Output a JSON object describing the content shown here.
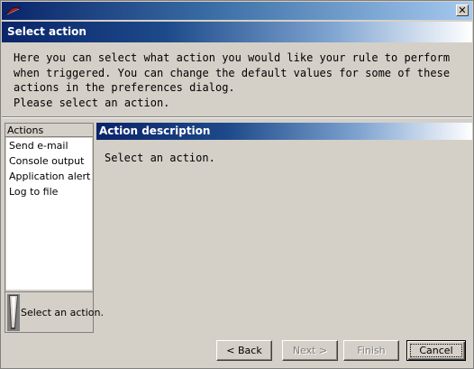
{
  "window": {
    "close_glyph": "✕"
  },
  "header": {
    "title": "Select action"
  },
  "intro": {
    "text": "Here you can select what action you would like your rule to perform\nwhen triggered. You can change the default values for some of these\nactions in the preferences dialog.\nPlease select an action."
  },
  "actions": {
    "header": "Actions",
    "items": [
      "Send e-mail",
      "Console output",
      "Application alert",
      "Log to file"
    ],
    "status_text": "Select an action.",
    "status_icon": "scroll-icon"
  },
  "description": {
    "title": "Action description",
    "text": "Select an action."
  },
  "buttons": {
    "back": "< Back",
    "next": "Next >",
    "finish": "Finish",
    "cancel": "Cancel"
  },
  "colors": {
    "title_gradient_start": "#0a246a",
    "title_gradient_end": "#a6caf0",
    "face": "#d4d0c8",
    "list_bg": "#ffffff"
  }
}
